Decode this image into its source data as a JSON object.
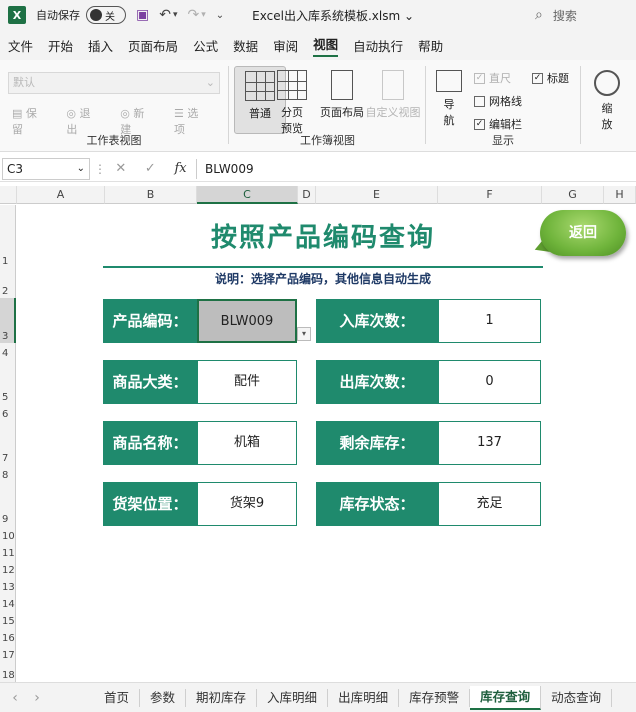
{
  "titlebar": {
    "logo": "X",
    "autosave_label": "自动保存",
    "toggle_state": "关",
    "filename": "Excel出入库系统模板.xlsm",
    "search_placeholder": "搜索"
  },
  "ribbon_tabs": [
    "文件",
    "开始",
    "插入",
    "页面布局",
    "公式",
    "数据",
    "审阅",
    "视图",
    "自动执行",
    "帮助"
  ],
  "ribbon": {
    "sheet_view": {
      "dropdown_value": "默认",
      "keep": "保留",
      "exit": "退出",
      "new": "新建",
      "options": "选项",
      "label": "工作表视图"
    },
    "workbook_view": {
      "normal": "普通",
      "page_break_1": "分页",
      "page_break_2": "预览",
      "page_layout": "页面布局",
      "custom_view": "自定义视图",
      "label": "工作簿视图"
    },
    "show": {
      "nav_1": "导",
      "nav_2": "航",
      "ruler": "直尺",
      "gridlines": "网格线",
      "formula_bar": "编辑栏",
      "headings": "标题",
      "label": "显示"
    },
    "zoom": {
      "line1": "缩",
      "line2": "放"
    }
  },
  "formula_bar": {
    "name_box": "C3",
    "fx": "fx",
    "value": "BLW009"
  },
  "columns": [
    "A",
    "B",
    "C",
    "D",
    "E",
    "F",
    "G",
    "H"
  ],
  "rows": [
    "1",
    "2",
    "3",
    "4",
    "5",
    "6",
    "7",
    "8",
    "9",
    "10",
    "11",
    "12",
    "13",
    "14",
    "15",
    "16",
    "17",
    "18"
  ],
  "sheet": {
    "title": "按照产品编码查询",
    "subtitle": "说明：选择产品编码，其他信息自动生成",
    "back_button": "返回",
    "fields": [
      {
        "label": "产品编码：",
        "value": "BLW009"
      },
      {
        "label": "商品大类：",
        "value": "配件"
      },
      {
        "label": "商品名称：",
        "value": "机箱"
      },
      {
        "label": "货架位置：",
        "value": "货架9"
      }
    ],
    "right_fields": [
      {
        "label": "入库次数：",
        "value": "1"
      },
      {
        "label": "出库次数：",
        "value": "0"
      },
      {
        "label": "剩余库存：",
        "value": "137"
      },
      {
        "label": "库存状态：",
        "value": "充足"
      }
    ]
  },
  "sheet_tabs": [
    "首页",
    "参数",
    "期初库存",
    "入库明细",
    "出库明细",
    "库存预警",
    "库存查询",
    "动态查询"
  ],
  "active_sheet_tab": "库存查询"
}
